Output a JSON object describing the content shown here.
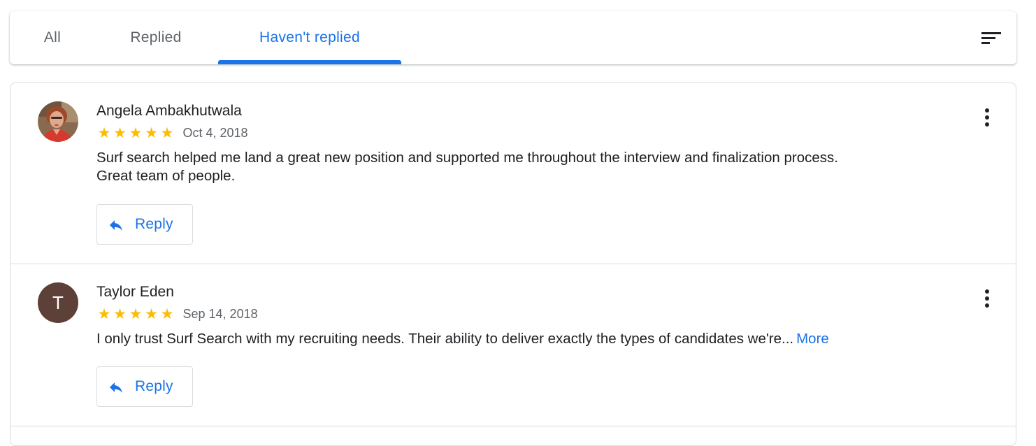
{
  "tabs": [
    {
      "label": "All"
    },
    {
      "label": "Replied"
    },
    {
      "label": "Haven't replied"
    }
  ],
  "active_tab": "Haven't replied",
  "icons": {
    "sort": "sort-icon",
    "reply": "reply-icon",
    "menu": "more-vert-icon",
    "star": "star-icon"
  },
  "colors": {
    "accent": "#1a73e8",
    "star": "#fbbc04",
    "avatar_letter_bg": "#5d4037"
  },
  "reviews": [
    {
      "name": "Angela Ambakhutwala",
      "rating": 5,
      "date": "Oct 4, 2018",
      "text_line1": "Surf search helped me land a great new position and supported me throughout the interview and finalization process.",
      "text_line2": "Great team of people.",
      "avatar": "photo",
      "reply_label": "Reply"
    },
    {
      "name": "Taylor Eden",
      "rating": 5,
      "date": "Sep 14, 2018",
      "text": "I only trust Surf Search with my recruiting needs. Their ability to deliver exactly the types of candidates we're...",
      "more_label": "More",
      "avatar_letter": "T",
      "reply_label": "Reply"
    }
  ]
}
